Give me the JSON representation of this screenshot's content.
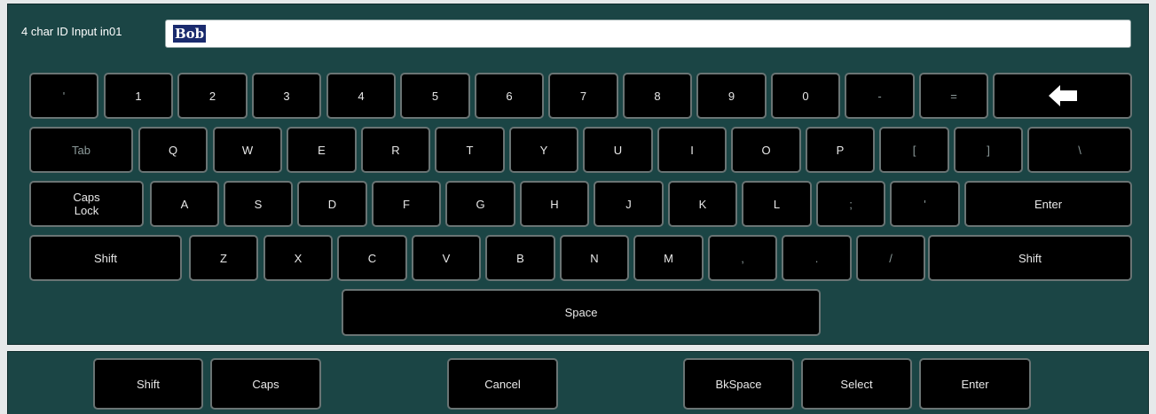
{
  "input": {
    "label": "4 char ID Input in01",
    "value": "Bob"
  },
  "rows": [
    [
      {
        "label": "'",
        "muted": true
      },
      {
        "label": "1"
      },
      {
        "label": "2"
      },
      {
        "label": "3"
      },
      {
        "label": "4"
      },
      {
        "label": "5"
      },
      {
        "label": "6"
      },
      {
        "label": "7"
      },
      {
        "label": "8"
      },
      {
        "label": "9"
      },
      {
        "label": "0"
      },
      {
        "label": "-",
        "muted": true
      },
      {
        "label": "=",
        "muted": true
      },
      {
        "label": "",
        "icon": "backspace-arrow-icon"
      }
    ],
    [
      {
        "label": "Tab",
        "muted": true
      },
      {
        "label": "Q"
      },
      {
        "label": "W"
      },
      {
        "label": "E"
      },
      {
        "label": "R"
      },
      {
        "label": "T"
      },
      {
        "label": "Y"
      },
      {
        "label": "U"
      },
      {
        "label": "I"
      },
      {
        "label": "O"
      },
      {
        "label": "P"
      },
      {
        "label": "[",
        "muted": true
      },
      {
        "label": "]",
        "muted": true
      },
      {
        "label": "\\",
        "muted": true
      }
    ],
    [
      {
        "label": "Caps Lock"
      },
      {
        "label": "A"
      },
      {
        "label": "S"
      },
      {
        "label": "D"
      },
      {
        "label": "F"
      },
      {
        "label": "G"
      },
      {
        "label": "H"
      },
      {
        "label": "J"
      },
      {
        "label": "K"
      },
      {
        "label": "L"
      },
      {
        "label": ";",
        "muted": true
      },
      {
        "label": "'",
        "muted": true
      },
      {
        "label": "Enter"
      }
    ],
    [
      {
        "label": "Shift"
      },
      {
        "label": "Z"
      },
      {
        "label": "X"
      },
      {
        "label": "C"
      },
      {
        "label": "V"
      },
      {
        "label": "B"
      },
      {
        "label": "N"
      },
      {
        "label": "M"
      },
      {
        "label": ",",
        "muted": true
      },
      {
        "label": ".",
        "muted": true
      },
      {
        "label": "/",
        "muted": true
      },
      {
        "label": "Shift"
      }
    ],
    [
      {
        "label": "Space"
      }
    ]
  ],
  "bottom_buttons": [
    {
      "label": "Shift"
    },
    {
      "label": "Caps"
    },
    {
      "label": "Cancel"
    },
    {
      "label": "BkSpace"
    },
    {
      "label": "Select"
    },
    {
      "label": "Enter"
    }
  ]
}
